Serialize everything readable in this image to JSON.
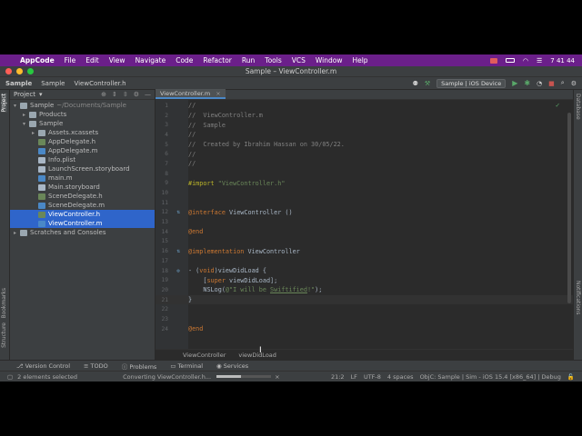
{
  "menubar": {
    "app": "AppCode",
    "items": [
      "File",
      "Edit",
      "View",
      "Navigate",
      "Code",
      "Refactor",
      "Run",
      "Tools",
      "VCS",
      "Window",
      "Help"
    ],
    "clock": "7 41 44"
  },
  "window": {
    "title": "Sample – ViewController.m"
  },
  "navbar": {
    "crumbs": [
      "Sample",
      "Sample",
      "ViewController.h"
    ],
    "config": "Sample | iOS Device"
  },
  "project": {
    "header": "Project",
    "tree": [
      {
        "label": "Sample",
        "extra": "~/Documents/Sample",
        "indent": 0,
        "arrow": "▾",
        "icon": "folder"
      },
      {
        "label": "Products",
        "indent": 1,
        "arrow": "▸",
        "icon": "folder"
      },
      {
        "label": "Sample",
        "indent": 1,
        "arrow": "▾",
        "icon": "folder"
      },
      {
        "label": "Assets.xcassets",
        "indent": 2,
        "arrow": "▸",
        "icon": "folder"
      },
      {
        "label": "AppDelegate.h",
        "indent": 2,
        "arrow": "",
        "icon": "file-h"
      },
      {
        "label": "AppDelegate.m",
        "indent": 2,
        "arrow": "",
        "icon": "file-m"
      },
      {
        "label": "Info.plist",
        "indent": 2,
        "arrow": "",
        "icon": "file-o"
      },
      {
        "label": "LaunchScreen.storyboard",
        "indent": 2,
        "arrow": "",
        "icon": "file-o"
      },
      {
        "label": "main.m",
        "indent": 2,
        "arrow": "",
        "icon": "file-m"
      },
      {
        "label": "Main.storyboard",
        "indent": 2,
        "arrow": "",
        "icon": "file-o"
      },
      {
        "label": "SceneDelegate.h",
        "indent": 2,
        "arrow": "",
        "icon": "file-h"
      },
      {
        "label": "SceneDelegate.m",
        "indent": 2,
        "arrow": "",
        "icon": "file-m"
      },
      {
        "label": "ViewController.h",
        "indent": 2,
        "arrow": "",
        "icon": "file-h",
        "selected": true
      },
      {
        "label": "ViewController.m",
        "indent": 2,
        "arrow": "",
        "icon": "file-m",
        "selected": true
      },
      {
        "label": "Scratches and Consoles",
        "indent": 0,
        "arrow": "▸",
        "icon": "folder"
      }
    ]
  },
  "editor": {
    "tab": "ViewController.m",
    "lines": [
      {
        "n": "1",
        "t": "//",
        "c": "c-com"
      },
      {
        "n": "2",
        "t": "//  ViewController.m",
        "c": "c-com"
      },
      {
        "n": "3",
        "t": "//  Sample",
        "c": "c-com"
      },
      {
        "n": "4",
        "t": "//",
        "c": "c-com"
      },
      {
        "n": "5",
        "t": "//  Created by Ibrahim Hassan on 30/05/22.",
        "c": "c-com"
      },
      {
        "n": "6",
        "t": "//",
        "c": "c-com"
      },
      {
        "n": "7",
        "t": "//",
        "c": "c-com"
      },
      {
        "n": "8",
        "t": "",
        "c": ""
      },
      {
        "n": "9",
        "t": "#import \"ViewController.h\"",
        "c": "import"
      },
      {
        "n": "10",
        "t": "",
        "c": ""
      },
      {
        "n": "11",
        "t": "",
        "c": ""
      },
      {
        "n": "12",
        "t": "@interface ViewController ()",
        "c": "iface",
        "mark": "⇅"
      },
      {
        "n": "13",
        "t": "",
        "c": ""
      },
      {
        "n": "14",
        "t": "@end",
        "c": "c-key"
      },
      {
        "n": "15",
        "t": "",
        "c": ""
      },
      {
        "n": "16",
        "t": "@implementation ViewController",
        "c": "impl",
        "mark": "⇅"
      },
      {
        "n": "17",
        "t": "",
        "c": ""
      },
      {
        "n": "18",
        "t": "- (void)viewDidLoad {",
        "c": "method",
        "mark": "⊚"
      },
      {
        "n": "19",
        "t": "    [super viewDidLoad];",
        "c": "super"
      },
      {
        "n": "20",
        "t": "    NSLog(@\"I will be Swiftified!\");",
        "c": "nslog"
      },
      {
        "n": "21",
        "t": "}",
        "c": "c-def",
        "cur": true
      },
      {
        "n": "22",
        "t": "",
        "c": ""
      },
      {
        "n": "23",
        "t": "",
        "c": ""
      },
      {
        "n": "24",
        "t": "@end",
        "c": "c-key"
      }
    ],
    "breadcrumbs": [
      "ViewController",
      "viewDidLoad"
    ]
  },
  "toolwindows": [
    "Version Control",
    "TODO",
    "Problems",
    "Terminal",
    "Services"
  ],
  "left_vertical": [
    "Project",
    "Bookmarks",
    "Structure"
  ],
  "right_vertical": [
    "Database",
    "Notifications"
  ],
  "status": {
    "left": "2 elements selected",
    "progress_text": "Converting ViewController.h...",
    "progress": 0.45,
    "position": "21:2",
    "line_sep": "LF",
    "encoding": "UTF-8",
    "indent": "4 spaces",
    "context": "ObjC: Sample | Sim - iOS 15.4 [x86_64] | Debug"
  }
}
